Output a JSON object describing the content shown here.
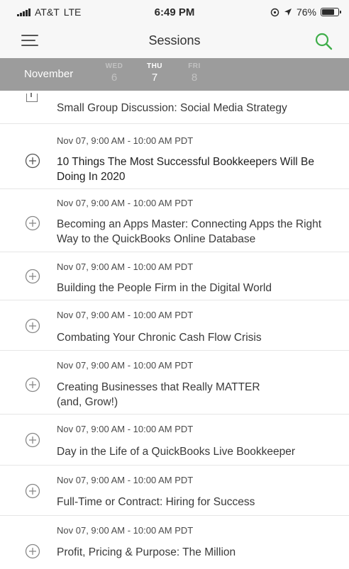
{
  "status_bar": {
    "carrier": "AT&T",
    "network": "LTE",
    "time": "6:49 PM",
    "battery_percent": "76%",
    "battery_level": 0.76,
    "icons": [
      "signal-icon",
      "location-lock-icon",
      "location-arrow-icon",
      "battery-icon"
    ]
  },
  "nav": {
    "title": "Sessions",
    "menu_icon": "hamburger-menu-icon",
    "search_icon": "search-icon",
    "accent_color": "#3fae4a"
  },
  "date_strip": {
    "month": "November",
    "days": [
      {
        "name": "WED",
        "num": "6",
        "active": false
      },
      {
        "name": "THU",
        "num": "7",
        "active": true
      },
      {
        "name": "FRI",
        "num": "8",
        "active": false
      }
    ],
    "background": "#9c9c9c"
  },
  "sessions": [
    {
      "time": "",
      "title": "Small Group Discussion: Social Media Strategy"
    },
    {
      "time": "Nov 07, 9:00 AM - 10:00 AM PDT",
      "title": "10 Things The Most Successful Bookkeepers Will Be Doing In 2020"
    },
    {
      "time": "Nov 07, 9:00 AM - 10:00 AM PDT",
      "title": "Becoming an Apps Master: Connecting Apps the Right Way to the QuickBooks Online Database"
    },
    {
      "time": "Nov 07, 9:00 AM - 10:00 AM PDT",
      "title": "Building the People Firm in the Digital World"
    },
    {
      "time": "Nov 07, 9:00 AM - 10:00 AM PDT",
      "title": "Combating Your Chronic Cash Flow Crisis"
    },
    {
      "time": "Nov 07, 9:00 AM - 10:00 AM PDT",
      "title": "Creating Businesses that Really MATTER (and, Grow!)"
    },
    {
      "time": "Nov 07, 9:00 AM - 10:00 AM PDT",
      "title": "Day in the Life of a QuickBooks Live Bookkeeper"
    },
    {
      "time": "Nov 07, 9:00 AM - 10:00 AM PDT",
      "title": "Full-Time or Contract: Hiring for Success"
    },
    {
      "time": "Nov 07, 9:00 AM - 10:00 AM PDT",
      "title": "Profit, Pricing & Purpose: The Million"
    }
  ]
}
